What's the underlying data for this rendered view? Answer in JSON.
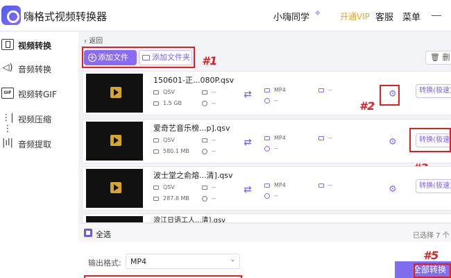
{
  "app": {
    "title": "嗨格式视频转换器",
    "user": "小嗨同学",
    "vip": "开通VIP",
    "service": "客服",
    "menu": "菜单"
  },
  "sidebar": {
    "items": [
      {
        "label": "视频转换",
        "icon": "video-convert-icon"
      },
      {
        "label": "音频转换",
        "icon": "speaker-icon"
      },
      {
        "label": "视频转GIF",
        "icon": "gif-icon"
      },
      {
        "label": "视频压缩",
        "icon": "compress-icon"
      },
      {
        "label": "音频提取",
        "icon": "waveform-icon"
      }
    ]
  },
  "toolbar": {
    "back": "返回",
    "add_file": "添加文件",
    "add_folder": "添加文件夹",
    "delete": "删"
  },
  "files": [
    {
      "name": "150601-正...080P.qsv",
      "src_format": "QSV",
      "src_res": "--",
      "src_size": "1.5 GB",
      "src_dur": "--",
      "dst_format": "MP4",
      "dst_res": "--",
      "dst_dur": "--",
      "convert": "转换(极速)"
    },
    {
      "name": "爱奇艺音乐榜...p].qsv",
      "src_format": "QSV",
      "src_res": "--",
      "src_size": "580.1 MB",
      "src_dur": "--",
      "dst_format": "MP4",
      "dst_res": "--",
      "dst_dur": "--",
      "convert": "转换(极速)"
    },
    {
      "name": "波士堂之俞熔...清].qsv",
      "src_format": "QSV",
      "src_res": "--",
      "src_size": "287.8 MB",
      "src_dur": "--",
      "dst_format": "MP4",
      "dst_res": "--",
      "dst_dur": "--",
      "convert": "转换(极速)"
    },
    {
      "name": "浪江日语工人...清].qsv"
    }
  ],
  "bottom": {
    "select_all": "全选",
    "selected_count": "已选择 7 个",
    "output_label": "输出格式:",
    "output_value": "MP4",
    "convert_all": "全部转换"
  },
  "annotations": [
    "#1",
    "#2",
    "#3",
    "#5"
  ],
  "colors": {
    "accent": "#8a6cf4",
    "vip": "#e7a51e",
    "annotation": "#e02020"
  }
}
